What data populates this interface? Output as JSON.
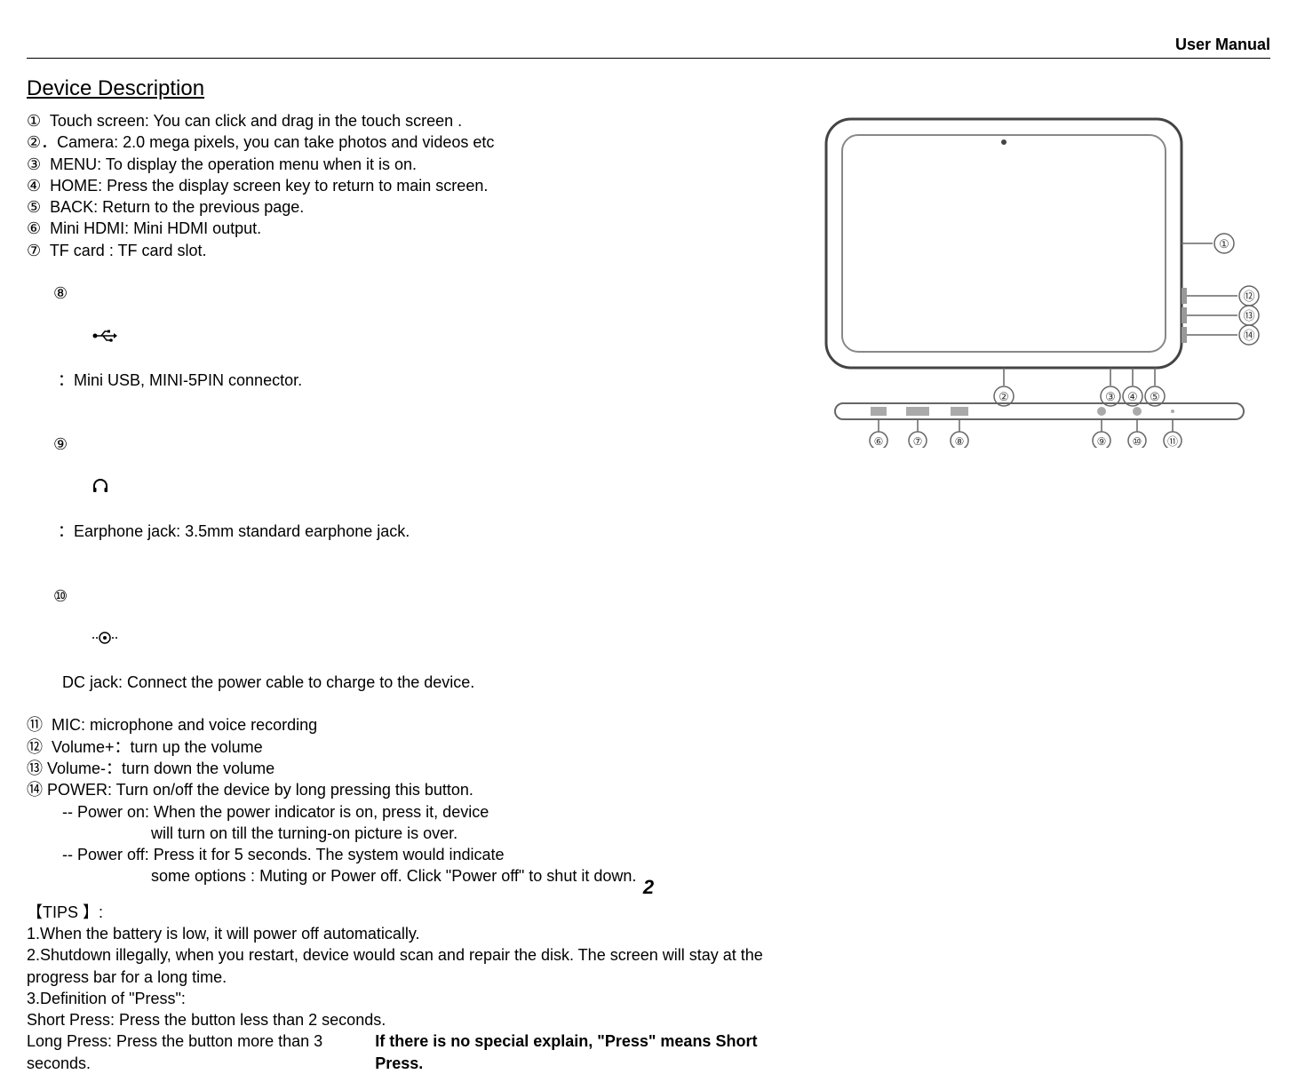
{
  "header": {
    "label": "User Manual"
  },
  "section": {
    "title": "Device Description                                                                                                                            "
  },
  "items": {
    "touch": "①  Touch screen: You can click and drag in the touch screen .",
    "camera": "②．Camera: 2.0 mega pixels, you can take photos and videos etc",
    "menu": "③  MENU: To display the operation menu when it is on.",
    "home": "④  HOME: Press the display screen key to return to main screen.",
    "back": "⑤  BACK: Return to the previous page.",
    "hdmi": "⑥  Mini HDMI: Mini HDMI output.",
    "tf": "⑦  TF card : TF card slot.",
    "usb_pre": "⑧ ",
    "usb_post": " ：Mini USB, MINI-5PIN connector.",
    "ear_pre": "⑨   ",
    "ear_post": " ：Earphone jack: 3.5mm standard earphone jack.",
    "dc_pre": "⑩  ",
    "dc_post": "  DC jack: Connect the power cable to charge to the device.",
    "mic": "⑪  MIC: microphone and voice recording",
    "volup": "⑫  Volume+：turn up the volume",
    "voldown": "⑬ Volume-：turn down the volume",
    "power": "⑭ POWER: Turn on/off the device by long pressing this button.",
    "power_on1": "-- Power on: When the power indicator is on, press it, device",
    "power_on2": "will turn on till the turning-on picture is over.",
    "power_off1": "-- Power off: Press it for 5 seconds. The system would indicate",
    "power_off2": "some options : Muting or Power off. Click \"Power off\" to shut it down."
  },
  "tips": {
    "title": "【TIPS 】:",
    "t1": "1.When the battery is low, it will power off automatically.",
    "t2": "2.Shutdown illegally, when you restart, device would scan and repair the disk. The screen will stay at the progress bar for a long time.",
    "t3": "3.Definition of \"Press\":",
    "short": "Short Press: Press the button less than 2 seconds.",
    "long": "Long Press: Press the button more than 3 seconds.",
    "note": "If there is no special explain, \"Press\" means Short Press."
  },
  "page_num": "2",
  "diagram": {
    "callouts_front": [
      "①"
    ],
    "callouts_side": [
      "⑫",
      "⑬",
      "⑭"
    ],
    "callouts_bottom_front": [
      "②",
      "③",
      "④",
      "⑤"
    ],
    "callouts_bottom_side": [
      "⑥",
      "⑦",
      "⑧",
      "⑨",
      "⑩",
      "⑪"
    ]
  }
}
